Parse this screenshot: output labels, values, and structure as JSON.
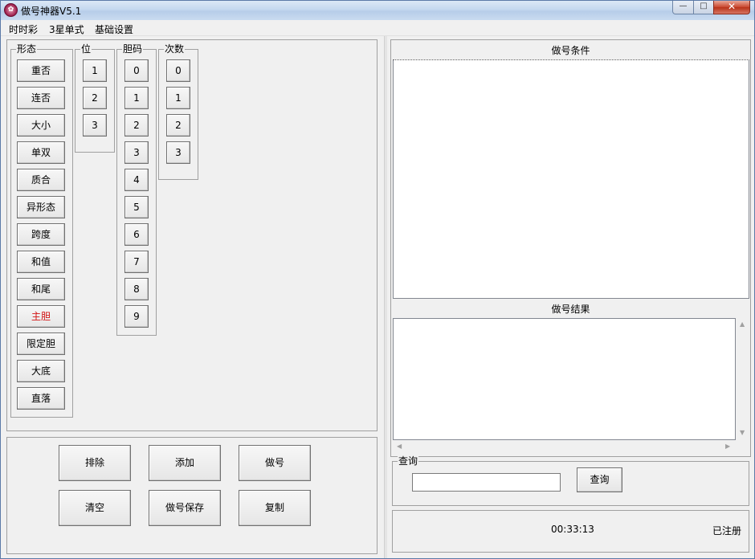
{
  "window": {
    "title": "做号神器V5.1",
    "app_icon_glyph": "✿",
    "controls": {
      "minimize": "—",
      "maximize": "□",
      "close": "✕"
    }
  },
  "menu": [
    "时时彩",
    "3星单式",
    "基础设置"
  ],
  "form_group": {
    "label": "形态",
    "buttons": [
      "重否",
      "连否",
      "大小",
      "单双",
      "质合",
      "异形态",
      "跨度",
      "和值",
      "和尾",
      "主胆",
      "限定胆",
      "大底",
      "直落"
    ],
    "highlight_color": "#d21414"
  },
  "position_group": {
    "label": "位",
    "buttons": [
      "1",
      "2",
      "3"
    ]
  },
  "dan_group": {
    "label": "胆码",
    "buttons": [
      "0",
      "1",
      "2",
      "3",
      "4",
      "5",
      "6",
      "7",
      "8",
      "9"
    ]
  },
  "count_group": {
    "label": "次数",
    "buttons": [
      "0",
      "1",
      "2",
      "3"
    ]
  },
  "actions": {
    "exclude": "排除",
    "add": "添加",
    "make": "做号",
    "clear": "清空",
    "save": "做号保存",
    "copy": "复制"
  },
  "conditions": {
    "header": "做号条件"
  },
  "results": {
    "header": "做号结果"
  },
  "query": {
    "label": "查询",
    "input_value": "",
    "button": "查询"
  },
  "status": {
    "time": "00:33:13",
    "registration": "已注册"
  }
}
